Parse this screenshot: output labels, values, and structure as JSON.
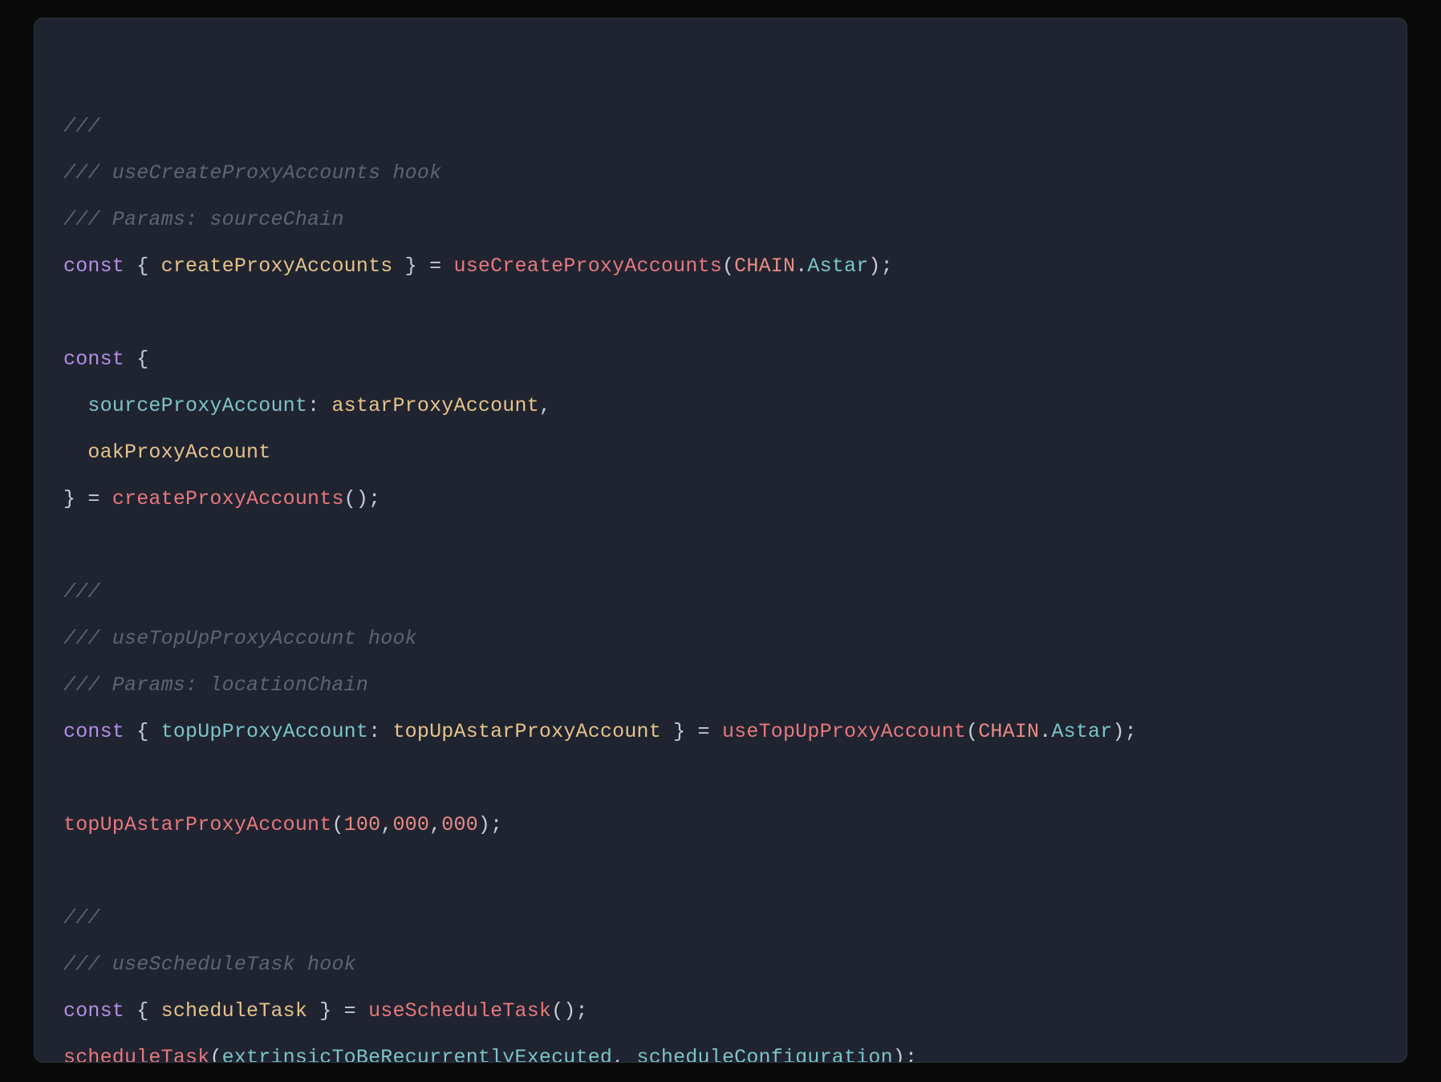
{
  "code": {
    "l01_a": "///",
    "l02_a": "/// useCreateProxyAccounts hook",
    "l03_a": "/// Params: sourceChain",
    "l04_a": "const",
    "l04_b": " { ",
    "l04_c": "createProxyAccounts",
    "l04_d": " } = ",
    "l04_e": "useCreateProxyAccounts",
    "l04_f": "(",
    "l04_g": "CHAIN",
    "l04_h": ".",
    "l04_i": "Astar",
    "l04_j": ");",
    "l05_a": "",
    "l06_a": "const",
    "l06_b": " {",
    "l07_a": "  ",
    "l07_b": "sourceProxyAccount",
    "l07_c": ": ",
    "l07_d": "astarProxyAccount",
    "l07_e": ",",
    "l08_a": "  ",
    "l08_b": "oakProxyAccount",
    "l09_a": "} = ",
    "l09_b": "createProxyAccounts",
    "l09_c": "();",
    "l10_a": "",
    "l11_a": "///",
    "l12_a": "/// useTopUpProxyAccount hook",
    "l13_a": "/// Params: locationChain",
    "l14_a": "const",
    "l14_b": " { ",
    "l14_c": "topUpProxyAccount",
    "l14_d": ": ",
    "l14_e": "topUpAstarProxyAccount",
    "l14_f": " } = ",
    "l14_g": "useTopUpProxyAccount",
    "l14_h": "(",
    "l14_i": "CHAIN",
    "l14_j": ".",
    "l14_k": "Astar",
    "l14_l": ");",
    "l15_a": "",
    "l16_a": "topUpAstarProxyAccount",
    "l16_b": "(",
    "l16_c": "100",
    "l16_d": ",",
    "l16_e": "000",
    "l16_f": ",",
    "l16_g": "000",
    "l16_h": ");",
    "l17_a": "",
    "l18_a": "///",
    "l19_a": "/// useScheduleTask hook",
    "l20_a": "const",
    "l20_b": " { ",
    "l20_c": "scheduleTask",
    "l20_d": " } = ",
    "l20_e": "useScheduleTask",
    "l20_f": "();",
    "l21_a": "scheduleTask",
    "l21_b": "(",
    "l21_c": "extrinsicToBeRecurrentlyExecuted",
    "l21_d": ", ",
    "l21_e": "scheduleConfiguration",
    "l21_f": ");"
  }
}
